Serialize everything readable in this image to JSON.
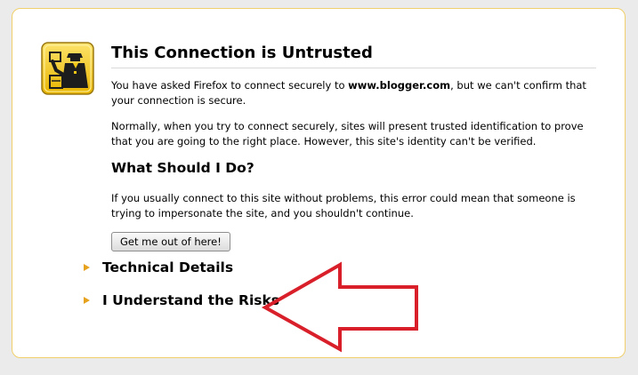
{
  "error_page": {
    "title": "This Connection is Untrusted",
    "paragraph1_prefix": "You have asked Firefox to connect securely to ",
    "paragraph1_host": "www.blogger.com",
    "paragraph1_suffix": ", but we can't confirm that your connection is secure.",
    "paragraph2": "Normally, when you try to connect securely, sites will present trusted identification to prove that you are going to the right place. However, this site's identity can't be verified.",
    "subtitle": "What Should I Do?",
    "paragraph3": "If you usually connect to this site without problems, this error could mean that someone is trying to impersonate the site, and you shouldn't continue.",
    "button_label": "Get me out of here!",
    "expanders": [
      {
        "label": "Technical Details"
      },
      {
        "label": "I Understand the Risks"
      }
    ]
  },
  "colors": {
    "page_background": "#ebebeb",
    "box_border": "#f1cf6a",
    "expander_triangle": "#e7a21d",
    "annotation_arrow": "#d81f2a",
    "icon_yellow": "#f5c816"
  },
  "icons": {
    "cert_icon": "untrusted-connection-officer-icon",
    "annotation": "red-arrow-annotation"
  }
}
